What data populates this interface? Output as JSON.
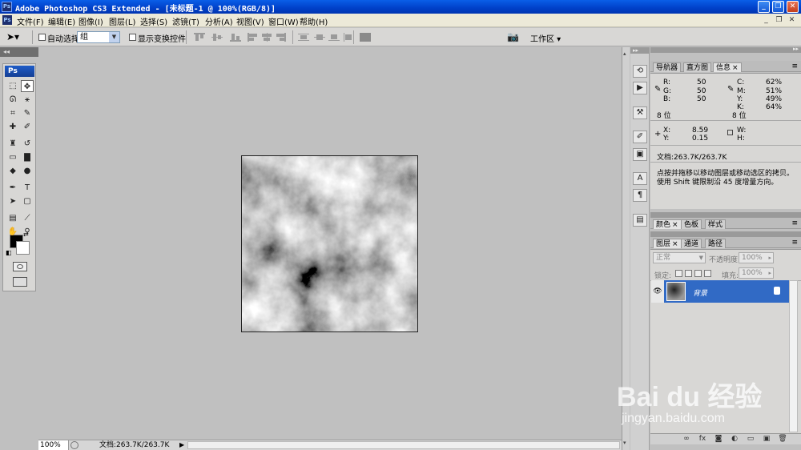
{
  "window": {
    "title": "Adobe Photoshop CS3 Extended - [未标题-1 @ 100%(RGB/8)]",
    "app_badge": "Ps",
    "minimize": "_",
    "restore": "❐",
    "close": "✕"
  },
  "menu": {
    "items": [
      "文件(F)",
      "编辑(E)",
      "图像(I)",
      "图层(L)",
      "选择(S)",
      "滤镜(T)",
      "分析(A)",
      "视图(V)",
      "窗口(W)",
      "帮助(H)"
    ]
  },
  "options": {
    "auto_select_label": "自动选择:",
    "auto_select_value": "组",
    "show_transform_label": "显示变换控件",
    "workspace_label": "工作区"
  },
  "left_strip": {
    "collapse": "◂◂"
  },
  "toolbox": {
    "logo": "Ps",
    "tools": [
      {
        "name": "marquee-tool",
        "glyph": "⬚"
      },
      {
        "name": "move-tool",
        "glyph": "✥"
      },
      {
        "name": "lasso-tool",
        "glyph": "ᘏ"
      },
      {
        "name": "magic-wand-tool",
        "glyph": "⚹"
      },
      {
        "name": "crop-tool",
        "glyph": "⌗"
      },
      {
        "name": "slice-tool",
        "glyph": "✎"
      },
      {
        "name": "healing-brush-tool",
        "glyph": "✚"
      },
      {
        "name": "brush-tool",
        "glyph": "✐"
      },
      {
        "name": "clone-stamp-tool",
        "glyph": "♜"
      },
      {
        "name": "history-brush-tool",
        "glyph": "↺"
      },
      {
        "name": "eraser-tool",
        "glyph": "▭"
      },
      {
        "name": "gradient-tool",
        "glyph": "▇"
      },
      {
        "name": "blur-tool",
        "glyph": "◆"
      },
      {
        "name": "dodge-tool",
        "glyph": "●"
      },
      {
        "name": "pen-tool",
        "glyph": "✒"
      },
      {
        "name": "type-tool",
        "glyph": "T"
      },
      {
        "name": "path-selection-tool",
        "glyph": "➤"
      },
      {
        "name": "shape-tool",
        "glyph": "▢"
      },
      {
        "name": "notes-tool",
        "glyph": "▤"
      },
      {
        "name": "eyedropper-tool",
        "glyph": "⟋"
      },
      {
        "name": "hand-tool",
        "glyph": "✋"
      },
      {
        "name": "zoom-tool",
        "glyph": "⚲"
      }
    ]
  },
  "status": {
    "zoom": "100%",
    "doc": "文档:263.7K/263.7K",
    "play": "▶"
  },
  "navigator_group": {
    "tabs": [
      "导航器",
      "直方图",
      "信息"
    ],
    "close_glyph": "×",
    "info": {
      "r_label": "R:",
      "r": "50",
      "g_label": "G:",
      "g": "50",
      "b_label": "B:",
      "b": "50",
      "c_label": "C:",
      "c": "62%",
      "m_label": "M:",
      "m": "51%",
      "y_label": "Y:",
      "y": "49%",
      "k_label": "K:",
      "k": "64%",
      "bits_left": "8 位",
      "bits_right": "8 位",
      "x_label": "X:",
      "x": "8.59",
      "y2_label": "Y:",
      "y2": "0.15",
      "w_label": "W:",
      "h_label": "H:",
      "doc": "文档:263.7K/263.7K",
      "hint1": "点按并拖移以移动图层或移动选区的拷贝。",
      "hint2": "使用 Shift 键限制沿 45 度增量方向。"
    }
  },
  "color_group": {
    "tabs": [
      "颜色",
      "色板",
      "样式"
    ]
  },
  "layers_group": {
    "tabs": [
      "图层",
      "通道",
      "路径"
    ],
    "blend_mode": "正常",
    "opacity_label": "不透明度:",
    "opacity": "100%",
    "lock_label": "锁定:",
    "fill_label": "填充:",
    "fill": "100%",
    "layer_name": "背景",
    "bottom_icons": [
      "∞",
      "fx",
      "◙",
      "◐",
      "▭",
      "▣",
      "🗑"
    ]
  },
  "watermark": {
    "line1": "Bai du 经验",
    "line2": "jingyan.baidu.com"
  }
}
